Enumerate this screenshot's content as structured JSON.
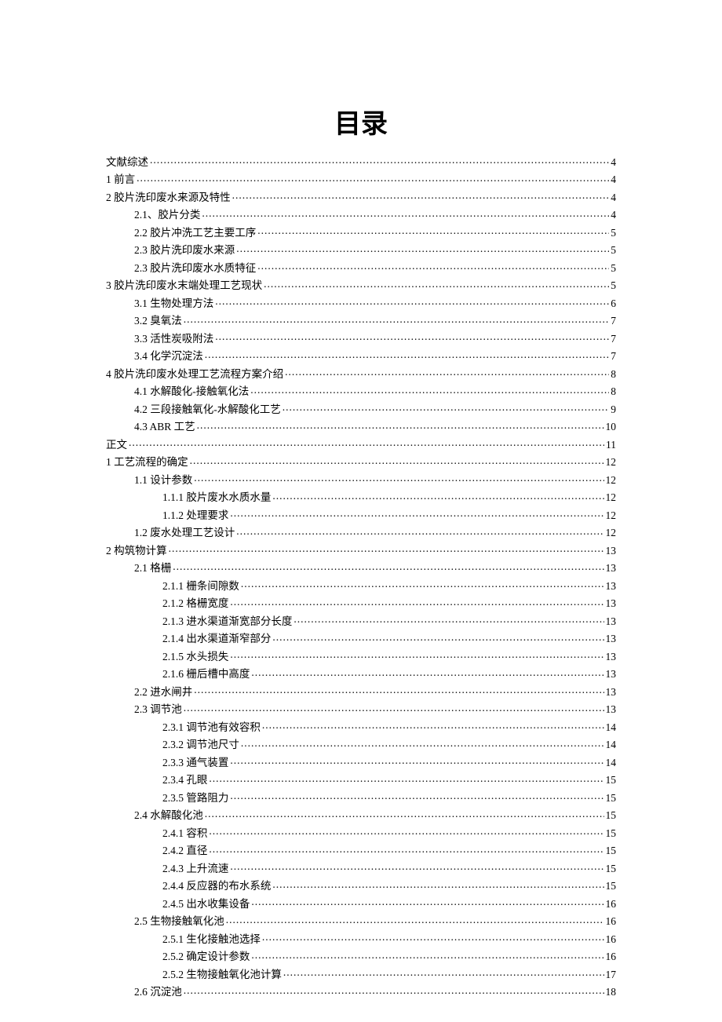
{
  "title": "目录",
  "toc": [
    {
      "level": 0,
      "label": "文献综述",
      "page": "4"
    },
    {
      "level": 0,
      "label": "1 前言",
      "page": "4"
    },
    {
      "level": 0,
      "label": "2 胶片洗印废水来源及特性",
      "page": "4"
    },
    {
      "level": 1,
      "label": "2.1、胶片分类",
      "page": "4"
    },
    {
      "level": 1,
      "label": "2.2 胶片冲洗工艺主要工序",
      "page": "5"
    },
    {
      "level": 1,
      "label": "2.3 胶片洗印废水来源",
      "page": "5"
    },
    {
      "level": 1,
      "label": "2.3 胶片洗印废水水质特征",
      "page": "5"
    },
    {
      "level": 0,
      "label": "3 胶片洗印废水末端处理工艺现状",
      "page": "5"
    },
    {
      "level": 1,
      "label": "3.1 生物处理方法",
      "page": "6"
    },
    {
      "level": 1,
      "label": "3.2 臭氧法",
      "page": "7"
    },
    {
      "level": 1,
      "label": "3.3 活性炭吸附法",
      "page": "7"
    },
    {
      "level": 1,
      "label": "3.4 化学沉淀法",
      "page": "7"
    },
    {
      "level": 0,
      "label": "4 胶片洗印废水处理工艺流程方案介绍",
      "page": "8"
    },
    {
      "level": 1,
      "label": "4.1  水解酸化-接触氧化法 ",
      "page": "8"
    },
    {
      "level": 1,
      "label": "4.2 三段接触氧化-水解酸化工艺 ",
      "page": "9"
    },
    {
      "level": 1,
      "label": "4.3 ABR 工艺 ",
      "page": "10"
    },
    {
      "level": 0,
      "label": "正文",
      "page": "11"
    },
    {
      "level": 0,
      "label": "1 工艺流程的确定",
      "page": "12"
    },
    {
      "level": 1,
      "label": "1.1 设计参数",
      "page": "12"
    },
    {
      "level": 2,
      "label": "1.1.1 胶片废水水质水量",
      "page": "12"
    },
    {
      "level": 2,
      "label": "1.1.2 处理要求",
      "page": "12"
    },
    {
      "level": 1,
      "label": "1.2 废水处理工艺设计",
      "page": "12"
    },
    {
      "level": 0,
      "label": "2 构筑物计算",
      "page": "13"
    },
    {
      "level": 1,
      "label": "2.1 格栅",
      "page": "13"
    },
    {
      "level": 2,
      "label": "2.1.1 栅条间隙数",
      "page": "13"
    },
    {
      "level": 2,
      "label": "2.1.2 格栅宽度",
      "page": "13"
    },
    {
      "level": 2,
      "label": "2.1.3 进水渠道渐宽部分长度",
      "page": "13"
    },
    {
      "level": 2,
      "label": "2.1.4 出水渠道渐窄部分",
      "page": "13"
    },
    {
      "level": 2,
      "label": "2.1.5 水头损失",
      "page": "13"
    },
    {
      "level": 2,
      "label": "2.1.6 栅后槽中高度",
      "page": "13"
    },
    {
      "level": 1,
      "label": "2.2 进水闸井",
      "page": "13"
    },
    {
      "level": 1,
      "label": "2.3 调节池",
      "page": "13"
    },
    {
      "level": 2,
      "label": "2.3.1 调节池有效容积",
      "page": "14"
    },
    {
      "level": 2,
      "label": "2.3.2 调节池尺寸",
      "page": "14"
    },
    {
      "level": 2,
      "label": "2.3.3 通气装置",
      "page": "14"
    },
    {
      "level": 2,
      "label": "2.3.4 孔眼",
      "page": "15"
    },
    {
      "level": 2,
      "label": "2.3.5 管路阻力",
      "page": "15"
    },
    {
      "level": 1,
      "label": "2.4 水解酸化池",
      "page": "15"
    },
    {
      "level": 2,
      "label": "2.4.1 容积",
      "page": "15"
    },
    {
      "level": 2,
      "label": "2.4.2 直径",
      "page": "15"
    },
    {
      "level": 2,
      "label": "2.4.3 上升流速",
      "page": "15"
    },
    {
      "level": 2,
      "label": "2.4.4 反应器的布水系统",
      "page": "15"
    },
    {
      "level": 2,
      "label": "2.4.5 出水收集设备",
      "page": "16"
    },
    {
      "level": 1,
      "label": "2.5 生物接触氧化池",
      "page": "16"
    },
    {
      "level": 2,
      "label": "2.5.1 生化接触池选择",
      "page": "16"
    },
    {
      "level": 2,
      "label": "2.5.2 确定设计参数",
      "page": "16"
    },
    {
      "level": 2,
      "label": "2.5.2 生物接触氧化池计算",
      "page": "17"
    },
    {
      "level": 1,
      "label": "2.6 沉淀池",
      "page": "18"
    }
  ]
}
